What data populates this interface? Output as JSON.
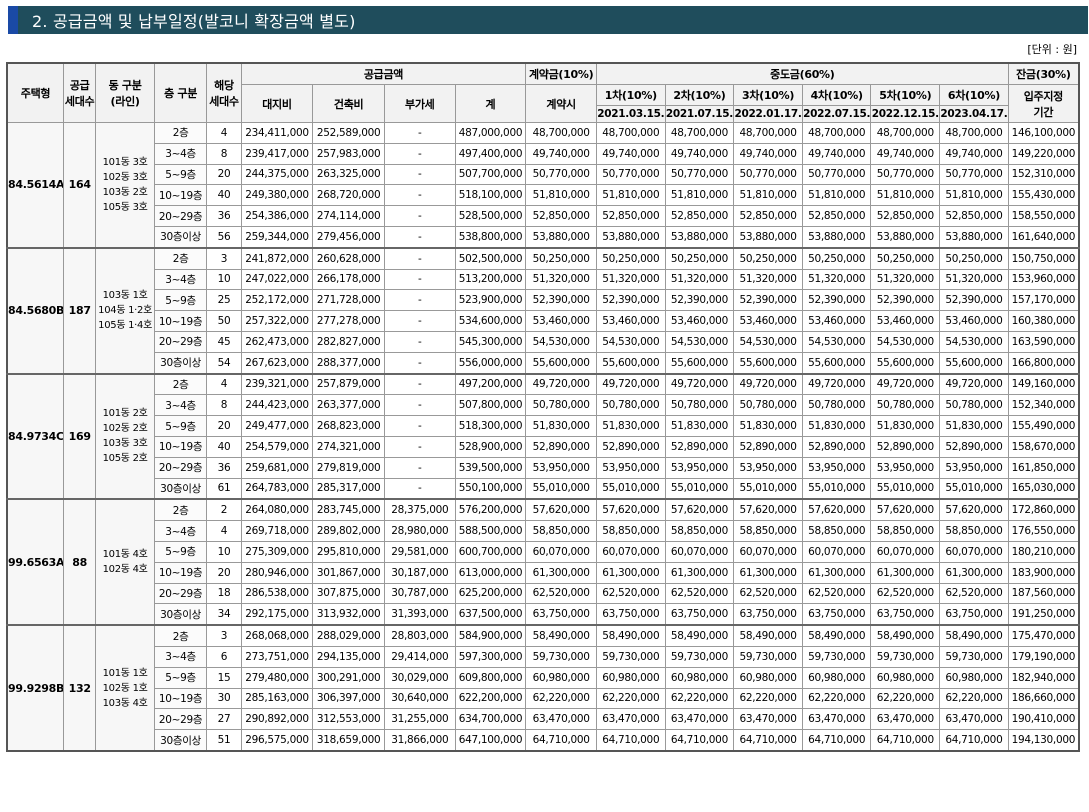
{
  "section_title": "2. 공급금액 및 납부일정(발코니 확장금액 별도)",
  "unit_label": "[단위 : 원]",
  "headers": {
    "house_type": "주택형",
    "supply_units": "공급\n세대수",
    "dong_line": "동 구분\n(라인)",
    "floor": "층 구분",
    "units": "해당\n세대수",
    "supply_price": "공급금액",
    "land": "대지비",
    "building": "건축비",
    "vat": "부가세",
    "total": "계",
    "deposit": "계약금(10%)",
    "deposit_sub": "계약시",
    "interim": "중도금(60%)",
    "balance": "잔금(30%)",
    "balance_sub": "입주지정\n기간",
    "installments": [
      {
        "label": "1차(10%)",
        "date": "2021.03.15."
      },
      {
        "label": "2차(10%)",
        "date": "2021.07.15."
      },
      {
        "label": "3차(10%)",
        "date": "2022.01.17."
      },
      {
        "label": "4차(10%)",
        "date": "2022.07.15."
      },
      {
        "label": "5차(10%)",
        "date": "2022.12.15."
      },
      {
        "label": "6차(10%)",
        "date": "2023.04.17."
      }
    ]
  },
  "groups": [
    {
      "type": "84.5614A",
      "supply": "164",
      "dong": "101동 3호\n102동 3호\n103동 2호\n105동 3호",
      "rows": [
        {
          "floor": "2층",
          "units": "4",
          "land": "234,411,000",
          "building": "252,589,000",
          "vat": "-",
          "total": "487,000,000",
          "deposit": "48,700,000",
          "interim": "48,700,000",
          "balance": "146,100,000"
        },
        {
          "floor": "3~4층",
          "units": "8",
          "land": "239,417,000",
          "building": "257,983,000",
          "vat": "-",
          "total": "497,400,000",
          "deposit": "49,740,000",
          "interim": "49,740,000",
          "balance": "149,220,000"
        },
        {
          "floor": "5~9층",
          "units": "20",
          "land": "244,375,000",
          "building": "263,325,000",
          "vat": "-",
          "total": "507,700,000",
          "deposit": "50,770,000",
          "interim": "50,770,000",
          "balance": "152,310,000"
        },
        {
          "floor": "10~19층",
          "units": "40",
          "land": "249,380,000",
          "building": "268,720,000",
          "vat": "-",
          "total": "518,100,000",
          "deposit": "51,810,000",
          "interim": "51,810,000",
          "balance": "155,430,000"
        },
        {
          "floor": "20~29층",
          "units": "36",
          "land": "254,386,000",
          "building": "274,114,000",
          "vat": "-",
          "total": "528,500,000",
          "deposit": "52,850,000",
          "interim": "52,850,000",
          "balance": "158,550,000"
        },
        {
          "floor": "30층이상",
          "units": "56",
          "land": "259,344,000",
          "building": "279,456,000",
          "vat": "-",
          "total": "538,800,000",
          "deposit": "53,880,000",
          "interim": "53,880,000",
          "balance": "161,640,000"
        }
      ]
    },
    {
      "type": "84.5680B",
      "supply": "187",
      "dong": "103동 1호\n104동 1·2호\n105동 1·4호",
      "rows": [
        {
          "floor": "2층",
          "units": "3",
          "land": "241,872,000",
          "building": "260,628,000",
          "vat": "-",
          "total": "502,500,000",
          "deposit": "50,250,000",
          "interim": "50,250,000",
          "balance": "150,750,000"
        },
        {
          "floor": "3~4층",
          "units": "10",
          "land": "247,022,000",
          "building": "266,178,000",
          "vat": "-",
          "total": "513,200,000",
          "deposit": "51,320,000",
          "interim": "51,320,000",
          "balance": "153,960,000"
        },
        {
          "floor": "5~9층",
          "units": "25",
          "land": "252,172,000",
          "building": "271,728,000",
          "vat": "-",
          "total": "523,900,000",
          "deposit": "52,390,000",
          "interim": "52,390,000",
          "balance": "157,170,000"
        },
        {
          "floor": "10~19층",
          "units": "50",
          "land": "257,322,000",
          "building": "277,278,000",
          "vat": "-",
          "total": "534,600,000",
          "deposit": "53,460,000",
          "interim": "53,460,000",
          "balance": "160,380,000"
        },
        {
          "floor": "20~29층",
          "units": "45",
          "land": "262,473,000",
          "building": "282,827,000",
          "vat": "-",
          "total": "545,300,000",
          "deposit": "54,530,000",
          "interim": "54,530,000",
          "balance": "163,590,000"
        },
        {
          "floor": "30층이상",
          "units": "54",
          "land": "267,623,000",
          "building": "288,377,000",
          "vat": "-",
          "total": "556,000,000",
          "deposit": "55,600,000",
          "interim": "55,600,000",
          "balance": "166,800,000"
        }
      ]
    },
    {
      "type": "84.9734C",
      "supply": "169",
      "dong": "101동 2호\n102동 2호\n103동 3호\n105동 2호",
      "rows": [
        {
          "floor": "2층",
          "units": "4",
          "land": "239,321,000",
          "building": "257,879,000",
          "vat": "-",
          "total": "497,200,000",
          "deposit": "49,720,000",
          "interim": "49,720,000",
          "balance": "149,160,000"
        },
        {
          "floor": "3~4층",
          "units": "8",
          "land": "244,423,000",
          "building": "263,377,000",
          "vat": "-",
          "total": "507,800,000",
          "deposit": "50,780,000",
          "interim": "50,780,000",
          "balance": "152,340,000"
        },
        {
          "floor": "5~9층",
          "units": "20",
          "land": "249,477,000",
          "building": "268,823,000",
          "vat": "-",
          "total": "518,300,000",
          "deposit": "51,830,000",
          "interim": "51,830,000",
          "balance": "155,490,000"
        },
        {
          "floor": "10~19층",
          "units": "40",
          "land": "254,579,000",
          "building": "274,321,000",
          "vat": "-",
          "total": "528,900,000",
          "deposit": "52,890,000",
          "interim": "52,890,000",
          "balance": "158,670,000"
        },
        {
          "floor": "20~29층",
          "units": "36",
          "land": "259,681,000",
          "building": "279,819,000",
          "vat": "-",
          "total": "539,500,000",
          "deposit": "53,950,000",
          "interim": "53,950,000",
          "balance": "161,850,000"
        },
        {
          "floor": "30층이상",
          "units": "61",
          "land": "264,783,000",
          "building": "285,317,000",
          "vat": "-",
          "total": "550,100,000",
          "deposit": "55,010,000",
          "interim": "55,010,000",
          "balance": "165,030,000"
        }
      ]
    },
    {
      "type": "99.6563A",
      "supply": "88",
      "dong": "101동 4호\n102동 4호",
      "rows": [
        {
          "floor": "2층",
          "units": "2",
          "land": "264,080,000",
          "building": "283,745,000",
          "vat": "28,375,000",
          "total": "576,200,000",
          "deposit": "57,620,000",
          "interim": "57,620,000",
          "balance": "172,860,000"
        },
        {
          "floor": "3~4층",
          "units": "4",
          "land": "269,718,000",
          "building": "289,802,000",
          "vat": "28,980,000",
          "total": "588,500,000",
          "deposit": "58,850,000",
          "interim": "58,850,000",
          "balance": "176,550,000"
        },
        {
          "floor": "5~9층",
          "units": "10",
          "land": "275,309,000",
          "building": "295,810,000",
          "vat": "29,581,000",
          "total": "600,700,000",
          "deposit": "60,070,000",
          "interim": "60,070,000",
          "balance": "180,210,000"
        },
        {
          "floor": "10~19층",
          "units": "20",
          "land": "280,946,000",
          "building": "301,867,000",
          "vat": "30,187,000",
          "total": "613,000,000",
          "deposit": "61,300,000",
          "interim": "61,300,000",
          "balance": "183,900,000"
        },
        {
          "floor": "20~29층",
          "units": "18",
          "land": "286,538,000",
          "building": "307,875,000",
          "vat": "30,787,000",
          "total": "625,200,000",
          "deposit": "62,520,000",
          "interim": "62,520,000",
          "balance": "187,560,000"
        },
        {
          "floor": "30층이상",
          "units": "34",
          "land": "292,175,000",
          "building": "313,932,000",
          "vat": "31,393,000",
          "total": "637,500,000",
          "deposit": "63,750,000",
          "interim": "63,750,000",
          "balance": "191,250,000"
        }
      ]
    },
    {
      "type": "99.9298B",
      "supply": "132",
      "dong": "101동 1호\n102동 1호\n103동 4호",
      "rows": [
        {
          "floor": "2층",
          "units": "3",
          "land": "268,068,000",
          "building": "288,029,000",
          "vat": "28,803,000",
          "total": "584,900,000",
          "deposit": "58,490,000",
          "interim": "58,490,000",
          "balance": "175,470,000"
        },
        {
          "floor": "3~4층",
          "units": "6",
          "land": "273,751,000",
          "building": "294,135,000",
          "vat": "29,414,000",
          "total": "597,300,000",
          "deposit": "59,730,000",
          "interim": "59,730,000",
          "balance": "179,190,000"
        },
        {
          "floor": "5~9층",
          "units": "15",
          "land": "279,480,000",
          "building": "300,291,000",
          "vat": "30,029,000",
          "total": "609,800,000",
          "deposit": "60,980,000",
          "interim": "60,980,000",
          "balance": "182,940,000"
        },
        {
          "floor": "10~19층",
          "units": "30",
          "land": "285,163,000",
          "building": "306,397,000",
          "vat": "30,640,000",
          "total": "622,200,000",
          "deposit": "62,220,000",
          "interim": "62,220,000",
          "balance": "186,660,000"
        },
        {
          "floor": "20~29층",
          "units": "27",
          "land": "290,892,000",
          "building": "312,553,000",
          "vat": "31,255,000",
          "total": "634,700,000",
          "deposit": "63,470,000",
          "interim": "63,470,000",
          "balance": "190,410,000"
        },
        {
          "floor": "30층이상",
          "units": "51",
          "land": "296,575,000",
          "building": "318,659,000",
          "vat": "31,866,000",
          "total": "647,100,000",
          "deposit": "64,710,000",
          "interim": "64,710,000",
          "balance": "194,130,000"
        }
      ]
    }
  ]
}
